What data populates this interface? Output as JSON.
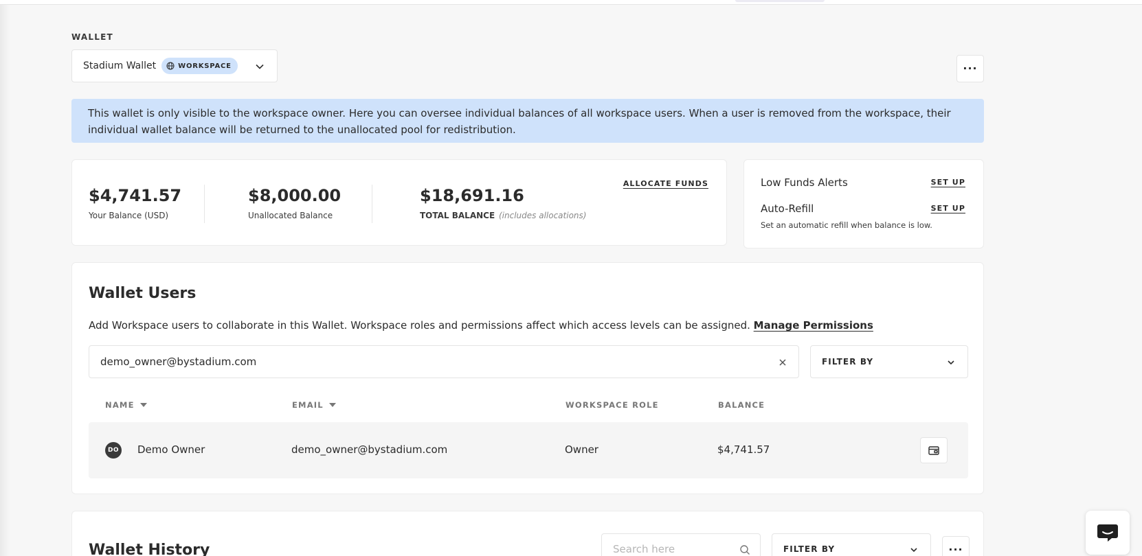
{
  "wallet": {
    "section_label": "WALLET",
    "selected_name": "Stadium Wallet",
    "badge": "WORKSPACE"
  },
  "info_banner": "This wallet is only visible to the workspace owner. Here you can oversee individual balances of all workspace users. When a user is removed from the workspace, their individual wallet balance will be returned to the unallocated pool for redistribution.",
  "balances": {
    "your_balance": {
      "value": "$4,741.57",
      "label": "Your Balance (USD)"
    },
    "unallocated": {
      "value": "$8,000.00",
      "label": "Unallocated Balance"
    },
    "total": {
      "value": "$18,691.16",
      "label": "TOTAL BALANCE",
      "note": "(includes allocations)"
    },
    "allocate_link": "ALLOCATE FUNDS"
  },
  "alerts": {
    "low_funds": {
      "title": "Low Funds Alerts",
      "link": "SET UP"
    },
    "auto_refill": {
      "title": "Auto-Refill",
      "link": "SET UP",
      "description": "Set an automatic refill when balance is low."
    }
  },
  "users": {
    "title": "Wallet Users",
    "description": "Add Workspace users to collaborate in this Wallet. Workspace roles and permissions affect which access levels can be assigned.",
    "manage_link": "Manage Permissions",
    "search_value": "demo_owner@bystadium.com",
    "filter_label": "FILTER BY",
    "columns": [
      "NAME",
      "EMAIL",
      "WORKSPACE ROLE",
      "BALANCE"
    ],
    "rows": [
      {
        "initials": "DO",
        "name": "Demo Owner",
        "email": "demo_owner@bystadium.com",
        "role": "Owner",
        "balance": "$4,741.57"
      }
    ]
  },
  "history": {
    "title": "Wallet History",
    "search_placeholder": "Search here",
    "filter_label": "FILTER BY"
  },
  "colors": {
    "accent_blue": "#cfe2fb",
    "background": "#f7f7f7",
    "text": "#2b2b2b"
  }
}
